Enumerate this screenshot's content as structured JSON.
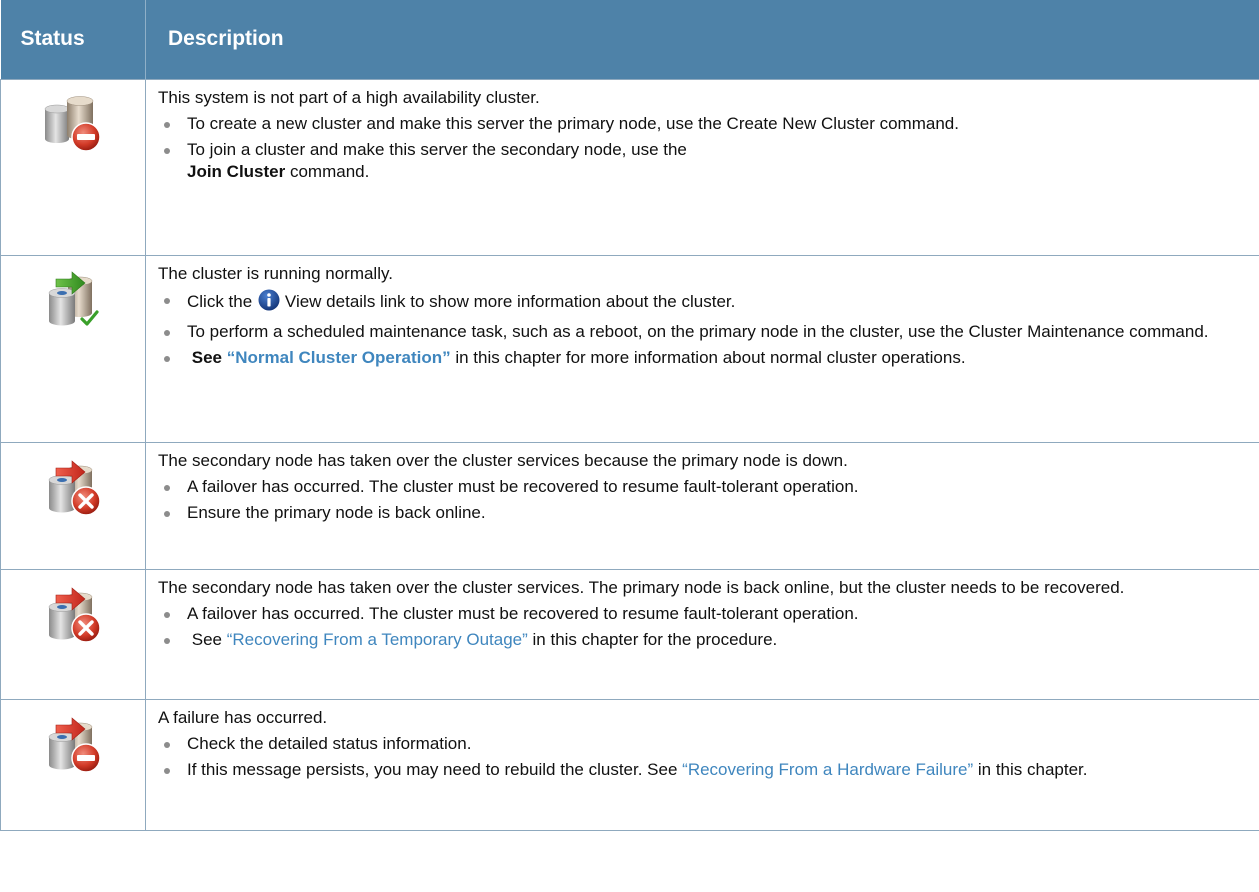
{
  "header": {
    "status": "Status",
    "description": "Description"
  },
  "rows": [
    {
      "icon": "db-not-clustered-icon",
      "intro": "This system is not part of a high availability cluster.",
      "b1": "To create a new cluster and make this server the primary node, use the Create New Cluster command.",
      "b2_a": "To join a cluster and make this server the secondary node, use the",
      "b2_bold": "Join Cluster",
      "b2_b": " command."
    },
    {
      "icon": "db-cluster-normal-icon",
      "intro": "The cluster is running normally.",
      "b1_a": "Click the",
      "b1_b": "View details link to show more information about the cluster.",
      "b2": "To perform a scheduled maintenance task, such as a reboot, on the primary node in the cluster, use the Cluster Maintenance command.",
      "b3_see": "See",
      "b3_link": "“Normal Cluster Operation”",
      "b3_rest": " in this chapter for more information about normal cluster operations."
    },
    {
      "icon": "db-failover-error-icon",
      "intro": "The secondary node has taken over the cluster services because the primary node is down.",
      "b1": "A failover has occurred. The cluster must be recovered to resume fault-tolerant operation.",
      "b2": "Ensure the primary node is back online."
    },
    {
      "icon": "db-failover-error-icon",
      "intro": "The secondary node has taken over the cluster services. The primary node is back online, but the cluster needs to be recovered.",
      "b1": "A failover has occurred. The cluster must be recovered to resume fault-tolerant operation.",
      "b2_a": "See ",
      "b2_link": "“Recovering From a Temporary Outage”",
      "b2_b": " in this chapter for the procedure."
    },
    {
      "icon": "db-failure-icon",
      "intro": "A failure has occurred.",
      "b1": "Check the detailed status information.",
      "b2_a": "If this message persists, you may need to rebuild the cluster.  See ",
      "b2_link": "“Recovering From a Hardware Failure”",
      "b2_b": " in this chapter."
    }
  ]
}
